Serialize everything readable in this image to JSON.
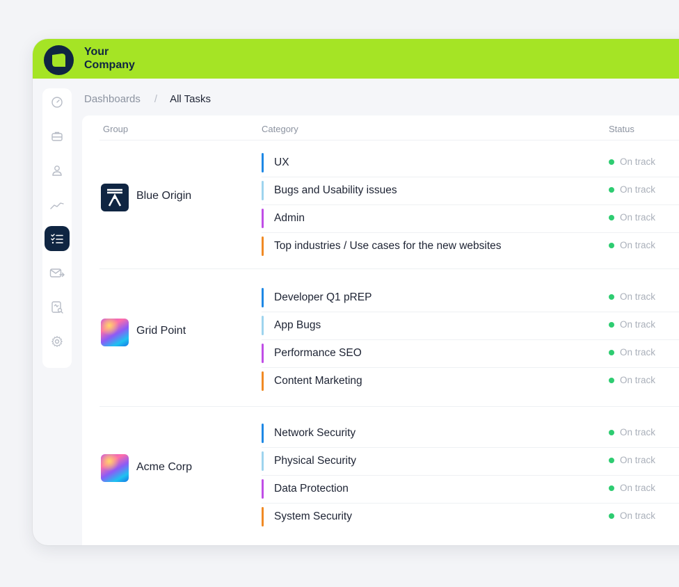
{
  "company": {
    "line1": "Your",
    "line2": "Company"
  },
  "colors": {
    "topbar": "#a5e425",
    "navy": "#0f2542",
    "status_green": "#2ecc71",
    "bar_blue": "#1e88e5",
    "bar_lightblue": "#9ed4ee",
    "bar_purple": "#c04ee6",
    "bar_orange": "#f08a24"
  },
  "sidebar": {
    "items": [
      {
        "icon": "gauge-icon",
        "active": false
      },
      {
        "icon": "briefcase-icon",
        "active": false
      },
      {
        "icon": "user-icon",
        "active": false
      },
      {
        "icon": "trend-icon",
        "active": false
      },
      {
        "icon": "checklist-icon",
        "active": true
      },
      {
        "icon": "mail-forward-icon",
        "active": false
      },
      {
        "icon": "report-search-icon",
        "active": false
      },
      {
        "icon": "gear-icon",
        "active": false
      }
    ]
  },
  "breadcrumb": {
    "root": "Dashboards",
    "separator": "/",
    "current": "All Tasks"
  },
  "table": {
    "headers": {
      "group": "Group",
      "category": "Category",
      "status": "Status"
    },
    "groups": [
      {
        "name": "Blue Origin",
        "logo": "blue-origin-logo",
        "tasks": [
          {
            "label": "UX",
            "bar": "blue",
            "status": "On track"
          },
          {
            "label": "Bugs and Usability issues",
            "bar": "lightblue",
            "status": "On track"
          },
          {
            "label": "Admin",
            "bar": "purple",
            "status": "On track"
          },
          {
            "label": "Top industries / Use cases for the new websites",
            "bar": "orange",
            "status": "On track"
          }
        ]
      },
      {
        "name": "Grid Point",
        "logo": "gradient-logo",
        "tasks": [
          {
            "label": "Developer Q1 pREP",
            "bar": "blue",
            "status": "On track"
          },
          {
            "label": "App Bugs",
            "bar": "lightblue",
            "status": "On track"
          },
          {
            "label": "Performance SEO",
            "bar": "purple",
            "status": "On track"
          },
          {
            "label": "Content Marketing",
            "bar": "orange",
            "status": "On track"
          }
        ]
      },
      {
        "name": "Acme Corp",
        "logo": "gradient-logo",
        "tasks": [
          {
            "label": "Network Security",
            "bar": "blue",
            "status": "On track"
          },
          {
            "label": "Physical Security",
            "bar": "lightblue",
            "status": "On track"
          },
          {
            "label": "Data Protection",
            "bar": "purple",
            "status": "On track"
          },
          {
            "label": "System Security",
            "bar": "orange",
            "status": "On track"
          }
        ]
      }
    ]
  }
}
